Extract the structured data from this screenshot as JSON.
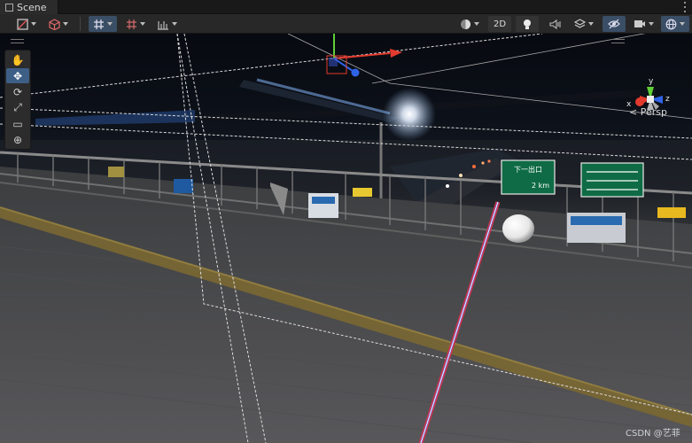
{
  "tab": {
    "title": "Scene",
    "icon": "grid-icon"
  },
  "toolbar": {
    "mode_2d_label": "2D",
    "buttons": [
      {
        "name": "draw-mode-button",
        "icon": "shaded-icon"
      },
      {
        "name": "render-paths-button",
        "icon": "cube-icon"
      },
      {
        "name": "grid-snap-button",
        "icon": "grid-snap-icon"
      },
      {
        "name": "increment-snap-button",
        "icon": "snap-grid-icon"
      },
      {
        "name": "gizmo-toggle-button",
        "icon": "ruler-icon"
      },
      {
        "name": "shading-button",
        "icon": "sphere-icon"
      },
      {
        "name": "lighting-button",
        "icon": "lightbulb-icon"
      },
      {
        "name": "audio-button",
        "icon": "audio-icon"
      },
      {
        "name": "effects-button",
        "icon": "layers-icon"
      },
      {
        "name": "hidden-objects-button",
        "icon": "eye-slash-icon"
      },
      {
        "name": "camera-button",
        "icon": "camera-icon"
      },
      {
        "name": "gizmos-button",
        "icon": "globe-icon"
      }
    ]
  },
  "tools": [
    {
      "name": "hand-tool",
      "icon": "hand-icon",
      "glyph": "✋",
      "active": false
    },
    {
      "name": "move-tool",
      "icon": "move-icon",
      "glyph": "✥",
      "active": true
    },
    {
      "name": "rotate-tool",
      "icon": "rotate-icon",
      "glyph": "⟳",
      "active": false
    },
    {
      "name": "scale-tool",
      "icon": "scale-icon",
      "glyph": "⤢",
      "active": false
    },
    {
      "name": "rect-tool",
      "icon": "rect-icon",
      "glyph": "▭",
      "active": false
    },
    {
      "name": "transform-tool",
      "icon": "transform-icon",
      "glyph": "⊕",
      "active": false
    }
  ],
  "scene_view": {
    "projection_label": "< Persp",
    "axis_labels": {
      "x": "x",
      "y": "y",
      "z": "z"
    },
    "signs": [
      {
        "top": "下一出口",
        "bottom": "2 km"
      }
    ]
  },
  "watermark": "CSDN @艺菲",
  "colors": {
    "accent": "#3d5f86",
    "axis_x": "#e23b2e",
    "axis_y": "#5fcf37",
    "axis_z": "#2f63e6"
  }
}
